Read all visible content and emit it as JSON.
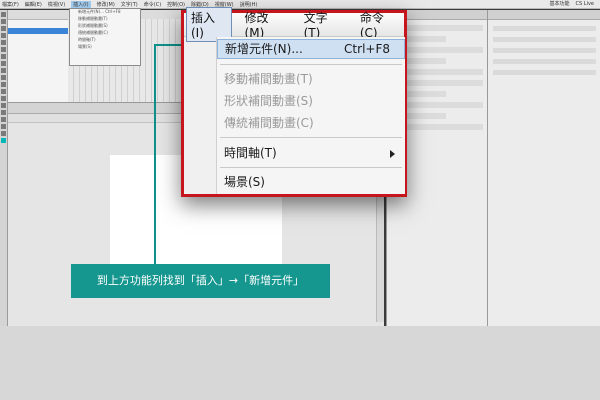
{
  "topbar": {
    "menus": [
      "檔案(F)",
      "編輯(E)",
      "檢視(V)",
      "插入(I)",
      "修改(M)",
      "文字(T)",
      "命令(C)",
      "控制(O)",
      "除錯(D)",
      "視窗(W)",
      "說明(H)"
    ],
    "right": [
      "基本功能",
      "CS Live"
    ]
  },
  "small_menu": {
    "items": [
      "新增元件(N)...   Ctrl+F8",
      "移動補間動畫(T)",
      "形狀補間動畫(S)",
      "傳統補間動畫(C)",
      "時間軸(T)",
      "場景(S)"
    ]
  },
  "popup": {
    "menubar": [
      "插入(I)",
      "修改(M)",
      "文字(T)",
      "命令(C)"
    ],
    "items": [
      {
        "label": "新增元件(N)...",
        "shortcut": "Ctrl+F8"
      },
      {
        "label": "移動補間動畫(T)"
      },
      {
        "label": "形狀補間動畫(S)"
      },
      {
        "label": "傳統補間動畫(C)"
      },
      {
        "label": "時間軸(T)"
      },
      {
        "label": "場景(S)"
      }
    ]
  },
  "callout": {
    "text": "到上方功能列找到「插入」→「新增元件」"
  },
  "colors": {
    "highlight_border": "#c5161d",
    "callout_bg": "#15968f",
    "accent_cyan": "#00b8b8"
  }
}
